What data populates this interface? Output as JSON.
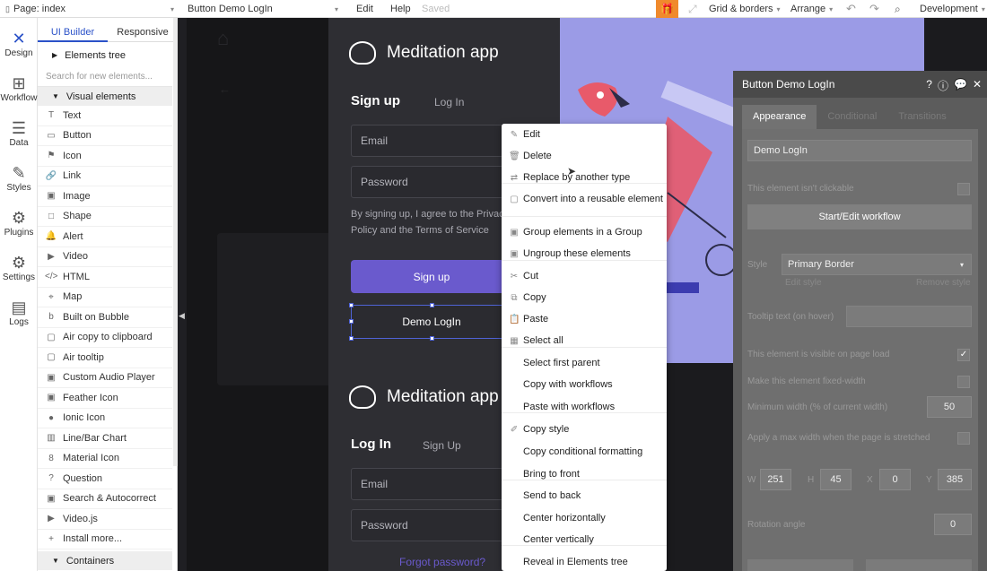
{
  "topbar": {
    "page_selector": "Page: index",
    "element_selector": "Button Demo LogIn",
    "edit": "Edit",
    "help": "Help",
    "saved": "Saved",
    "grid": "Grid & borders",
    "arrange": "Arrange",
    "env": "Development"
  },
  "rail": [
    {
      "label": "Design",
      "icon": "design-icon"
    },
    {
      "label": "Workflow",
      "icon": "workflow-icon"
    },
    {
      "label": "Data",
      "icon": "data-icon"
    },
    {
      "label": "Styles",
      "icon": "styles-icon"
    },
    {
      "label": "Plugins",
      "icon": "plugins-icon"
    },
    {
      "label": "Settings",
      "icon": "settings-icon"
    },
    {
      "label": "Logs",
      "icon": "logs-icon"
    }
  ],
  "panel": {
    "tabs": [
      "UI Builder",
      "Responsive"
    ],
    "elements_tree": "Elements tree",
    "search_placeholder": "Search for new elements...",
    "visual_elements": "Visual elements",
    "elements": [
      {
        "label": "Text",
        "icon": "T"
      },
      {
        "label": "Button",
        "icon": "▭"
      },
      {
        "label": "Icon",
        "icon": "⚑"
      },
      {
        "label": "Link",
        "icon": "🔗"
      },
      {
        "label": "Image",
        "icon": "▣"
      },
      {
        "label": "Shape",
        "icon": "□"
      },
      {
        "label": "Alert",
        "icon": "🔔"
      },
      {
        "label": "Video",
        "icon": "▶"
      },
      {
        "label": "HTML",
        "icon": "</>"
      },
      {
        "label": "Map",
        "icon": "⌖"
      },
      {
        "label": "Built on Bubble",
        "icon": "b"
      },
      {
        "label": "Air copy to clipboard",
        "icon": "▢"
      },
      {
        "label": "Air tooltip",
        "icon": "▢"
      },
      {
        "label": "Custom Audio Player",
        "icon": "▣"
      },
      {
        "label": "Feather Icon",
        "icon": "▣"
      },
      {
        "label": "Ionic Icon",
        "icon": "●"
      },
      {
        "label": "Line/Bar Chart",
        "icon": "▥"
      },
      {
        "label": "Material Icon",
        "icon": "8"
      },
      {
        "label": "Question",
        "icon": "?"
      },
      {
        "label": "Search & Autocorrect",
        "icon": "▣"
      },
      {
        "label": "Video.js",
        "icon": "▶"
      },
      {
        "label": "Install more...",
        "icon": "+"
      }
    ],
    "containers": "Containers"
  },
  "canvas": {
    "brand_title": "Meditation app",
    "signup_tab": "Sign up",
    "login_tab": "Log In",
    "email_placeholder": "Email",
    "password_placeholder": "Password",
    "terms_text": "By signing up, I agree to the Privacy Policy and the Terms of Service",
    "signup_button": "Sign up",
    "demo_button": "Demo LogIn",
    "brand_title_2": "Meditation app",
    "login_tab_2": "Log In",
    "signup_tab_2": "Sign Up",
    "email_placeholder_2": "Email",
    "password_placeholder_2": "Password",
    "forgot": "Forgot password?"
  },
  "context_menu": [
    {
      "label": "Edit",
      "icon": "✎"
    },
    {
      "label": "Delete",
      "icon": "🗑"
    },
    {
      "label": "Replace by another type",
      "icon": "⇄"
    },
    {
      "label": "Convert into a reusable element",
      "icon": "▢"
    },
    {
      "label": "Group elements in a Group",
      "icon": "▣"
    },
    {
      "label": "Ungroup these elements",
      "icon": "▣"
    },
    {
      "label": "Cut",
      "icon": "✂"
    },
    {
      "label": "Copy",
      "icon": "⧉"
    },
    {
      "label": "Paste",
      "icon": "📋"
    },
    {
      "label": "Select all",
      "icon": "▦"
    },
    {
      "label": "Select first parent",
      "icon": ""
    },
    {
      "label": "Copy with workflows",
      "icon": ""
    },
    {
      "label": "Paste with workflows",
      "icon": ""
    },
    {
      "label": "Copy style",
      "icon": "✐"
    },
    {
      "label": "Copy conditional formatting",
      "icon": ""
    },
    {
      "label": "Bring to front",
      "icon": ""
    },
    {
      "label": "Send to back",
      "icon": ""
    },
    {
      "label": "Center horizontally",
      "icon": ""
    },
    {
      "label": "Center vertically",
      "icon": ""
    },
    {
      "label": "Reveal in Elements tree",
      "icon": ""
    }
  ],
  "props": {
    "title": "Button Demo LogIn",
    "tabs": [
      "Appearance",
      "Conditional",
      "Transitions"
    ],
    "text_value": "Demo LogIn",
    "not_clickable": "This element isn't clickable",
    "workflow_button": "Start/Edit workflow",
    "style_label": "Style",
    "style_value": "Primary Border",
    "edit_style": "Edit style",
    "remove_style": "Remove style",
    "tooltip_label": "Tooltip text (on hover)",
    "visible_label": "This element is visible on page load",
    "fixed_label": "Make this element fixed-width",
    "min_width_label": "Minimum width (% of current width)",
    "min_width_value": "50",
    "max_width_label": "Apply a max width when the page is stretched",
    "w_label": "W",
    "w_value": "251",
    "h_label": "H",
    "h_value": "45",
    "x_label": "X",
    "x_value": "0",
    "y_label": "Y",
    "y_value": "385",
    "rotation_label": "Rotation angle",
    "rotation_value": "0"
  }
}
